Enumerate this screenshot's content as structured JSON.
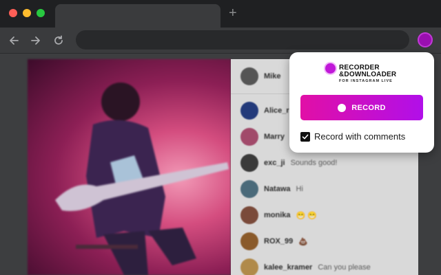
{
  "browser": {
    "traffic_lights": [
      "#ff5f57",
      "#febc2e",
      "#28c840"
    ],
    "new_tab_icon": "plus-icon",
    "nav_icons": [
      "back-arrow-icon",
      "forward-arrow-icon",
      "reload-icon"
    ],
    "extension_icon_color": "#9a0fb0"
  },
  "live": {
    "host": "Mike",
    "comments": [
      {
        "user": "Alice_r",
        "text": "",
        "avatar_color": "#233a7a"
      },
      {
        "user": "Marry",
        "text": "",
        "avatar_color": "#a14a6a"
      },
      {
        "user": "exc_ji",
        "text": "Sounds good!",
        "avatar_color": "#3a3a3a"
      },
      {
        "user": "Natawa",
        "text": "Hi",
        "avatar_color": "#4a6a7a"
      },
      {
        "user": "monika",
        "text": "😁 😁",
        "avatar_color": "#7a4a3a"
      },
      {
        "user": "ROX_99",
        "text": "💩",
        "avatar_color": "#8a5a2a"
      },
      {
        "user": "kalee_kramer",
        "text": "Can you please",
        "avatar_color": "#b08a4a"
      }
    ],
    "host_avatar_color": "#555555"
  },
  "popup": {
    "logo_line1": "RECORDER",
    "logo_line2": "&DOWNLOADER",
    "logo_sub": "FOR INSTAGRAM LIVE",
    "record_label": "RECORD",
    "checkbox_label": "Record with comments",
    "checkbox_checked": true,
    "accent_start": "#e10fa6",
    "accent_end": "#b10fe9"
  }
}
